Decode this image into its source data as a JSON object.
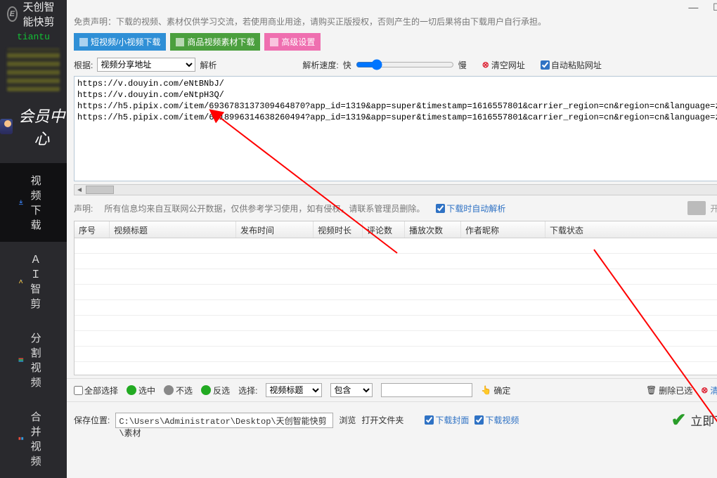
{
  "app": {
    "title": "天创智能快剪",
    "brand": "tiantu"
  },
  "vip": {
    "label": "会员中心"
  },
  "nav": {
    "items": [
      {
        "label": "视频下载",
        "active": true
      },
      {
        "label": "ＡＩ 智剪"
      },
      {
        "label": "分割视频"
      },
      {
        "label": "合并视频"
      }
    ]
  },
  "disclaimer": "免责声明：下载的视频、素材仅供学习交流，若使用商业用途，请购买正版授权，否则产生的一切后果将由下载用户自行承担。",
  "tabs": {
    "t1": "短视频/小视频下载",
    "t2": "商品视频素材下载",
    "t3": "高级设置"
  },
  "root": {
    "label": "根据:",
    "select": "视频分享地址",
    "parse": "解析",
    "speed_label": "解析速度:",
    "fast": "快",
    "slow": "慢",
    "clear": "清空网址",
    "autopaste": "自动粘贴网址"
  },
  "urls": "https://v.douyin.com/eNtBNbJ/\nhttps://v.douyin.com/eNtpH3Q/\nhttps://h5.pipix.com/item/6936783137309464870?app_id=1319&app=super&timestamp=1616557801&carrier_region=cn&region=cn&language=zh&ut\nhttps://h5.pipix.com/item/6918996314638260494?app_id=1319&app=super&timestamp=1616557801&carrier_region=cn&region=cn&language=zh&ut",
  "statement": {
    "prefix": "声明:",
    "text": "所有信息均来自互联网公开数据，仅供参考学习使用，如有侵权，请联系管理员删除。",
    "auto": "下载时自动解析",
    "start": "开始解析"
  },
  "table": {
    "cols": [
      "序号",
      "视频标题",
      "发布时间",
      "视频时长",
      "评论数",
      "播放次数",
      "作者昵称",
      "下载状态"
    ]
  },
  "footer1": {
    "selectall": "全部选择",
    "sel": "选中",
    "unsel": "不选",
    "invert": "反选",
    "selby": "选择:",
    "selby_opt": "视频标题",
    "contain": "包含",
    "confirm": "确定",
    "delsel": "删除已选",
    "cleartable": "清空表格"
  },
  "footer2": {
    "save_label": "保存位置:",
    "path": "C:\\Users\\Administrator\\Desktop\\天创智能快剪\\素材",
    "browse": "浏览",
    "openfolder": "打开文件夹",
    "cover": "下载封面",
    "video": "下载视频",
    "download_now": "立即下载"
  }
}
